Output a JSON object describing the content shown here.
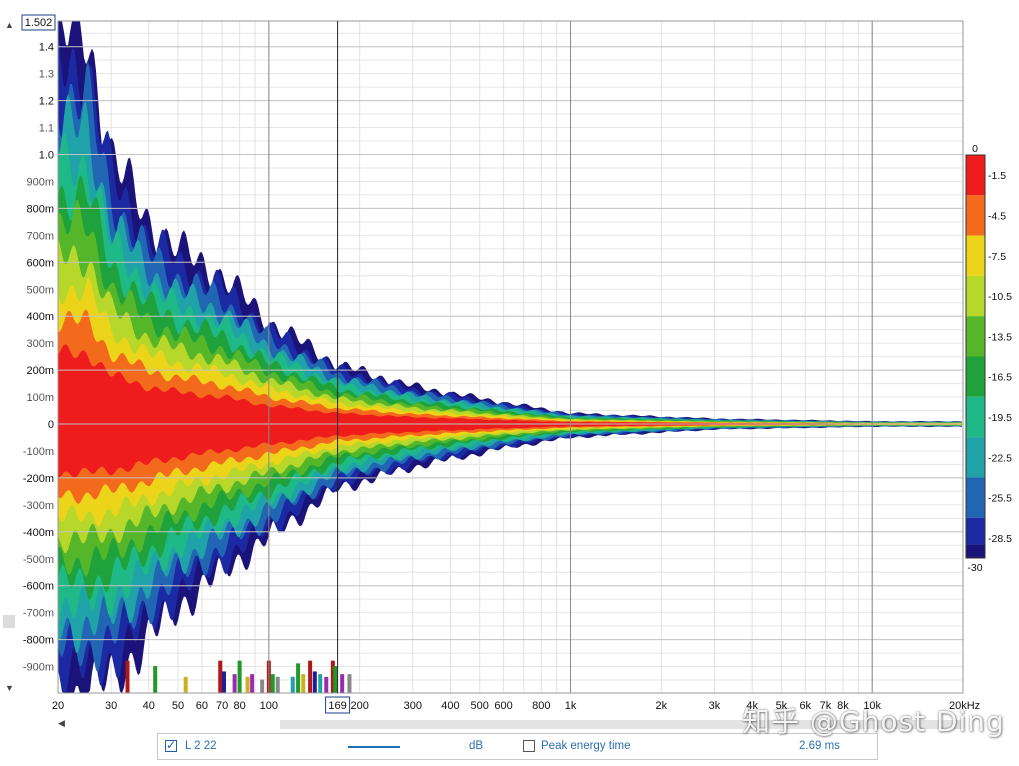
{
  "chart_data": {
    "type": "heatmap",
    "title": "",
    "xlabel": "",
    "ylabel": "",
    "x_scale": "log",
    "x_range_hz": [
      20,
      20000
    ],
    "y_range_s": [
      -1.0,
      1.502
    ],
    "y_ticks": [
      "1.4",
      "1.3",
      "1.2",
      "1.1",
      "1.0",
      "900m",
      "800m",
      "700m",
      "600m",
      "500m",
      "400m",
      "300m",
      "200m",
      "100m",
      "0",
      "-100m",
      "-200m",
      "-300m",
      "-400m",
      "-500m",
      "-600m",
      "-700m",
      "-800m",
      "-900m"
    ],
    "y_tick_values": [
      1.4,
      1.3,
      1.2,
      1.1,
      1.0,
      0.9,
      0.8,
      0.7,
      0.6,
      0.5,
      0.4,
      0.3,
      0.2,
      0.1,
      0,
      -0.1,
      -0.2,
      -0.3,
      -0.4,
      -0.5,
      -0.6,
      -0.7,
      -0.8,
      -0.9
    ],
    "y_major": [
      1.4,
      1.2,
      1.0,
      0.8,
      0.6,
      0.4,
      0.2,
      0,
      -0.2,
      -0.4,
      -0.6,
      -0.8
    ],
    "x_ticks": [
      "20",
      "30",
      "40",
      "50",
      "60",
      "70",
      "80",
      "100",
      "200",
      "300",
      "400",
      "500",
      "600",
      "800",
      "1k",
      "2k",
      "3k",
      "4k",
      "5k",
      "6k",
      "7k",
      "8k",
      "10k",
      "20kHz"
    ],
    "x_tick_values": [
      20,
      30,
      40,
      50,
      60,
      70,
      80,
      100,
      200,
      300,
      400,
      500,
      600,
      800,
      1000,
      2000,
      3000,
      4000,
      5000,
      6000,
      7000,
      8000,
      10000,
      20000
    ],
    "cursor": {
      "freq_hz": 169,
      "label": "169",
      "top_value": "1.502"
    },
    "color_scale": {
      "unit": "dB",
      "labels": [
        "0",
        "-1.5",
        "-4.5",
        "-7.5",
        "-10.5",
        "-13.5",
        "-16.5",
        "-19.5",
        "-22.5",
        "-25.5",
        "-28.5",
        "-30"
      ],
      "label_values": [
        0,
        -1.5,
        -4.5,
        -7.5,
        -10.5,
        -13.5,
        -16.5,
        -19.5,
        -22.5,
        -25.5,
        -28.5,
        -30
      ],
      "colors": [
        "#ee1c1c",
        "#f46a1c",
        "#ecd41a",
        "#b7d72a",
        "#55b62a",
        "#1fa23c",
        "#1fb887",
        "#1fa3a8",
        "#2166b3",
        "#1b2aa2",
        "#1c137a"
      ]
    },
    "envelope": {
      "description_units": "freq_hz, seconds half-width by level",
      "freqs": [
        20,
        25,
        30,
        40,
        50,
        70,
        100,
        169,
        300,
        600,
        1000,
        3000,
        10000,
        20000
      ],
      "pos_extent_s": [
        1.45,
        1.45,
        1.0,
        0.75,
        0.65,
        0.55,
        0.38,
        0.22,
        0.14,
        0.08,
        0.04,
        0.02,
        0.01,
        0.01
      ],
      "neg_extent_s": [
        -1.0,
        -1.0,
        -0.95,
        -0.8,
        -0.68,
        -0.55,
        -0.42,
        -0.24,
        -0.16,
        -0.09,
        -0.05,
        -0.02,
        -0.01,
        -0.01
      ]
    },
    "bottom_bars": [
      {
        "f": 34,
        "h": 0.12,
        "c": "#b01818"
      },
      {
        "f": 42,
        "h": 0.1,
        "c": "#1f9a2a"
      },
      {
        "f": 53,
        "h": 0.06,
        "c": "#c8b21e"
      },
      {
        "f": 69,
        "h": 0.12,
        "c": "#b01818"
      },
      {
        "f": 71,
        "h": 0.08,
        "c": "#1c1e9a"
      },
      {
        "f": 77,
        "h": 0.07,
        "c": "#9a2ab0"
      },
      {
        "f": 80,
        "h": 0.12,
        "c": "#1f9a2a"
      },
      {
        "f": 85,
        "h": 0.06,
        "c": "#c8b21e"
      },
      {
        "f": 88,
        "h": 0.07,
        "c": "#9a2ab0"
      },
      {
        "f": 95,
        "h": 0.05,
        "c": "#888888"
      },
      {
        "f": 100,
        "h": 0.12,
        "c": "#b01818"
      },
      {
        "f": 103,
        "h": 0.07,
        "c": "#1f9a2a"
      },
      {
        "f": 107,
        "h": 0.06,
        "c": "#888888"
      },
      {
        "f": 120,
        "h": 0.06,
        "c": "#1fa3a8"
      },
      {
        "f": 125,
        "h": 0.11,
        "c": "#1f9a2a"
      },
      {
        "f": 130,
        "h": 0.07,
        "c": "#c8b21e"
      },
      {
        "f": 137,
        "h": 0.12,
        "c": "#b01818"
      },
      {
        "f": 142,
        "h": 0.08,
        "c": "#1c1e9a"
      },
      {
        "f": 148,
        "h": 0.07,
        "c": "#1fa3a8"
      },
      {
        "f": 155,
        "h": 0.06,
        "c": "#9a2ab0"
      },
      {
        "f": 163,
        "h": 0.12,
        "c": "#b01818"
      },
      {
        "f": 166,
        "h": 0.1,
        "c": "#1f9a2a"
      },
      {
        "f": 175,
        "h": 0.07,
        "c": "#9a2ab0"
      },
      {
        "f": 185,
        "h": 0.07,
        "c": "#888888"
      }
    ]
  },
  "legend": {
    "series_label": "L 2 22",
    "series_checked": true,
    "unit_label": "dB",
    "peak_label": "Peak energy time",
    "peak_checked": false,
    "peak_value": "2.69 ms",
    "line_color": "#1f6fb5"
  },
  "watermark": "知乎 @Ghost Ding"
}
